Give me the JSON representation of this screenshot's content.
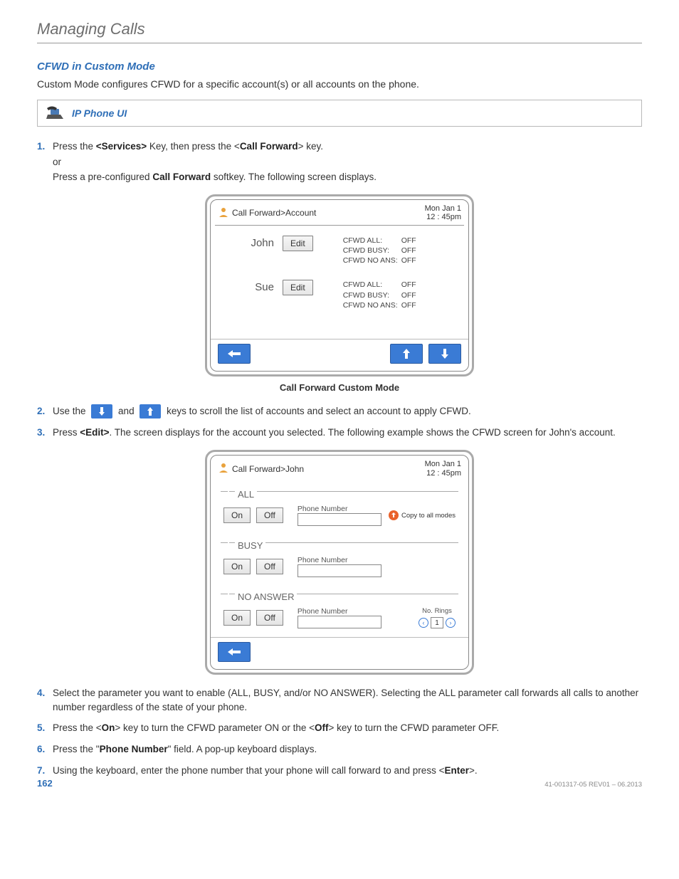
{
  "header": {
    "title": "Managing Calls"
  },
  "section": {
    "title": "CFWD in Custom Mode"
  },
  "intro": "Custom Mode configures CFWD for a specific account(s) or all accounts on the phone.",
  "callout": {
    "label": "IP Phone UI"
  },
  "steps": {
    "s1": {
      "num": "1.",
      "line1_a": "Press the ",
      "line1_b": "<Services>",
      "line1_c": " Key, then press the <",
      "line1_d": "Call Forward",
      "line1_e": "> key.",
      "line2": "or",
      "line3_a": "Press a pre-configured ",
      "line3_b": "Call Forward",
      "line3_c": " softkey. The following screen displays."
    },
    "s2": {
      "num": "2.",
      "a": "Use the ",
      "b": " and ",
      "c": " keys to scroll the list of accounts and select an account to apply CFWD."
    },
    "s3": {
      "num": "3.",
      "a": "Press ",
      "b": "<Edit>",
      "c": ". The screen displays for the account you selected. The following example shows the CFWD screen for John's account."
    },
    "s4": {
      "num": "4.",
      "text": "Select the parameter you want to enable (ALL, BUSY, and/or NO ANSWER). Selecting the ALL parameter call forwards all calls to another number regardless of the state of your phone."
    },
    "s5": {
      "num": "5.",
      "a": "Press the <",
      "b": "On",
      "c": "> key to turn the CFWD parameter ON or the <",
      "d": "Off",
      "e": "> key to turn the CFWD parameter OFF."
    },
    "s6": {
      "num": "6.",
      "a": "Press the \"",
      "b": "Phone Number",
      "c": "\" field. A pop-up keyboard displays."
    },
    "s7": {
      "num": "7.",
      "a": "Using the keyboard, enter the phone number that your phone will call forward to and press <",
      "b": "Enter",
      "c": ">."
    }
  },
  "phone1": {
    "breadcrumb": "Call Forward>Account",
    "date": "Mon Jan 1",
    "time": "12 : 45pm",
    "accounts": [
      {
        "name": "John",
        "edit": "Edit",
        "cfwd_all_lbl": "CFWD ALL:",
        "cfwd_all_val": "OFF",
        "cfwd_busy_lbl": "CFWD BUSY:",
        "cfwd_busy_val": "OFF",
        "cfwd_na_lbl": "CFWD NO ANS:",
        "cfwd_na_val": "OFF"
      },
      {
        "name": "Sue",
        "edit": "Edit",
        "cfwd_all_lbl": "CFWD ALL:",
        "cfwd_all_val": "OFF",
        "cfwd_busy_lbl": "CFWD BUSY:",
        "cfwd_busy_val": "OFF",
        "cfwd_na_lbl": "CFWD NO ANS:",
        "cfwd_na_val": "OFF"
      }
    ],
    "caption": "Call Forward Custom Mode"
  },
  "phone2": {
    "breadcrumb": "Call Forward>John",
    "date": "Mon Jan 1",
    "time": "12 : 45pm",
    "groups": {
      "all": {
        "label": "ALL",
        "on": "On",
        "off": "Off",
        "pn": "Phone Number",
        "copy": "Copy to all modes"
      },
      "busy": {
        "label": "BUSY",
        "on": "On",
        "off": "Off",
        "pn": "Phone Number"
      },
      "na": {
        "label": "NO ANSWER",
        "on": "On",
        "off": "Off",
        "pn": "Phone Number",
        "rings_lbl": "No. Rings",
        "rings_val": "1"
      }
    }
  },
  "footer": {
    "page": "162",
    "docid": "41-001317-05 REV01 – 06.2013"
  }
}
